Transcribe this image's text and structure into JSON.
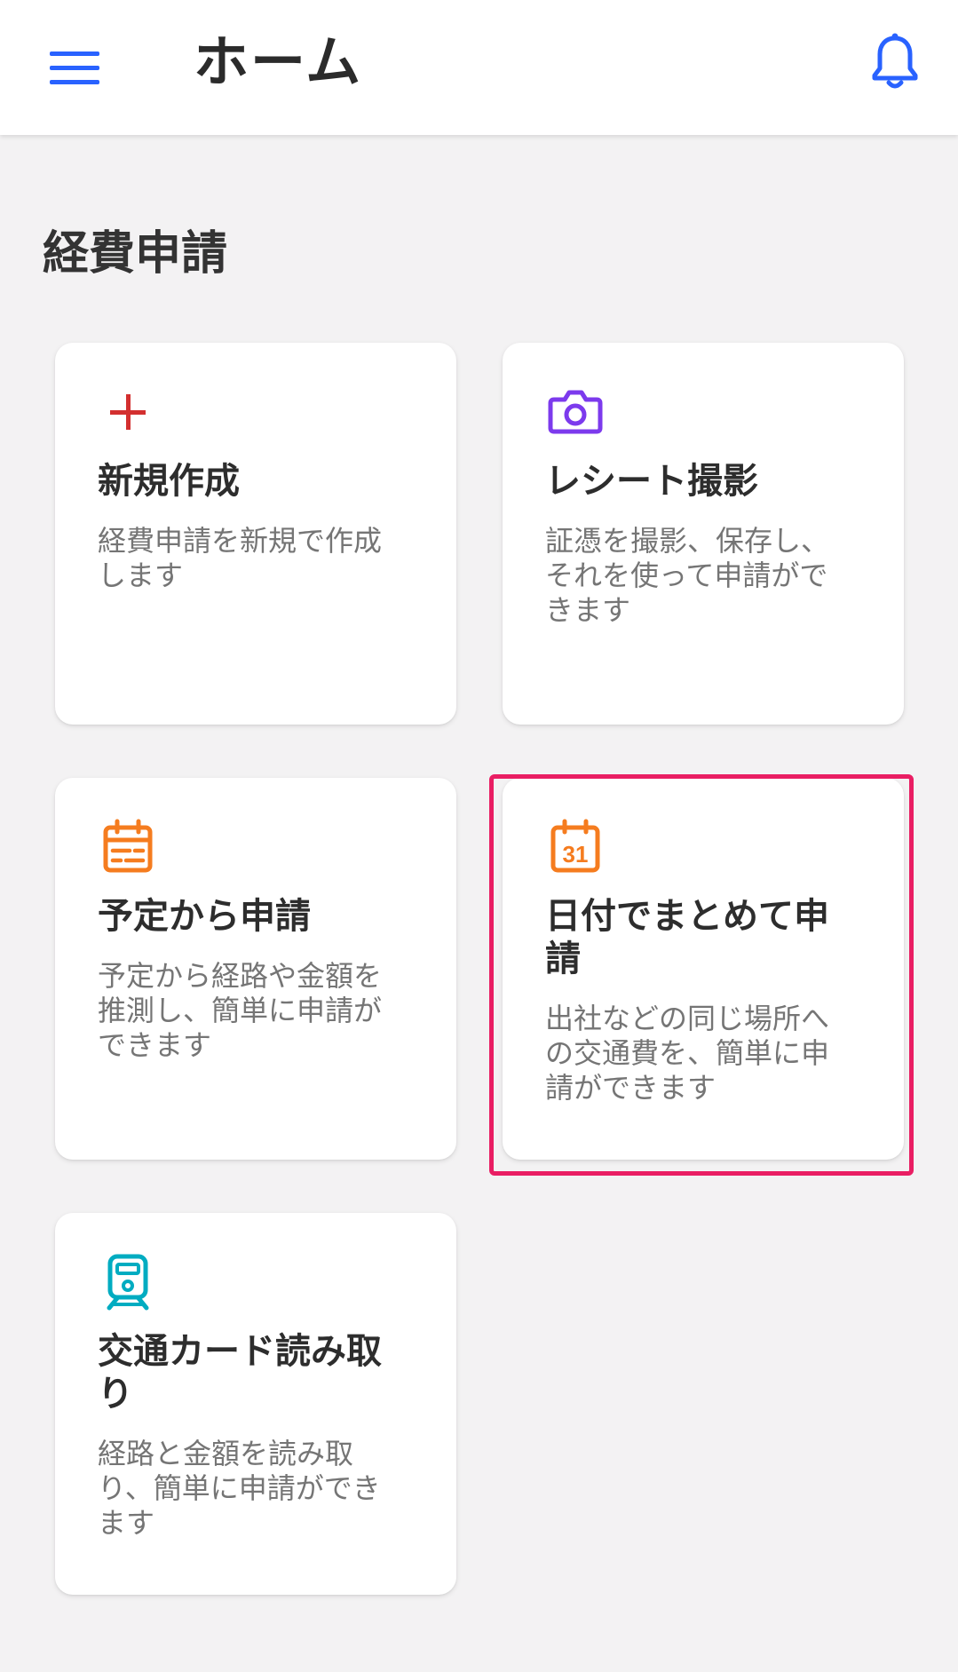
{
  "header": {
    "title": "ホーム",
    "menu_icon": "hamburger-menu-icon",
    "notification_icon": "bell-icon",
    "accent_color": "#2962ff"
  },
  "section": {
    "title": "経費申請"
  },
  "cards": [
    {
      "icon": "plus-icon",
      "icon_color": "#d32f2f",
      "title": "新規作成",
      "desc_lines": [
        "経費申請を新規で作成",
        "します"
      ]
    },
    {
      "icon": "camera-icon",
      "icon_color": "#7c3aed",
      "title": "レシート撮影",
      "desc_lines": [
        "証憑を撮影、保存し、",
        "それを使って申請がで",
        "きます"
      ]
    },
    {
      "icon": "calendar-icon",
      "icon_color": "#f57c1f",
      "title": "予定から申請",
      "desc_lines": [
        "予定から経路や金額を",
        "推測し、簡単に申請が",
        "できます"
      ]
    },
    {
      "icon": "calendar-31-icon",
      "icon_color": "#f57c1f",
      "icon_text": "31",
      "title_lines": [
        "日付でまとめて申",
        "請"
      ],
      "desc_lines": [
        "出社などの同じ場所へ",
        "の交通費を、簡単に申",
        "請ができます"
      ],
      "highlighted": true,
      "highlight_color": "#e91e63"
    },
    {
      "icon": "train-icon",
      "icon_color": "#00acc1",
      "title_lines": [
        "交通カード読み取",
        "り"
      ],
      "desc_lines": [
        "経路と金額を読み取",
        "り、簡単に申請ができ",
        "ます"
      ]
    }
  ]
}
